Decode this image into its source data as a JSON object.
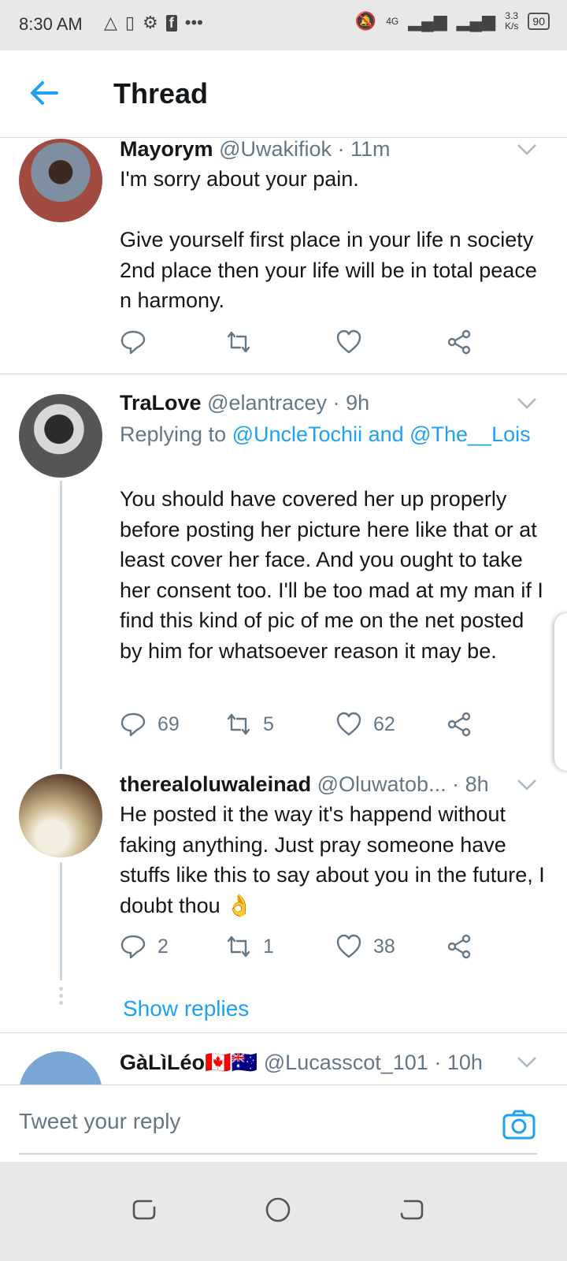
{
  "status_bar": {
    "time": "8:30 AM",
    "network": "4G",
    "speed_value": "3.3",
    "speed_unit": "K/s",
    "battery": "90"
  },
  "header": {
    "title": "Thread"
  },
  "tweets": [
    {
      "name": "Mayorym",
      "handle": "@Uwakifiok",
      "time": "11m",
      "body": "I'm sorry about your pain.\n\nGive yourself first place in your life n society 2nd place then your life will be in total peace n harmony.",
      "replies": "",
      "retweets": "",
      "likes": ""
    },
    {
      "name": "TraLove",
      "handle": "@elantracey",
      "time": "9h",
      "replying_prefix": "Replying to ",
      "replying_to": "@UncleTochii and @The__Lois",
      "body": "You should have covered her up properly before posting her picture here like that or at least cover her face. And you ought to take her consent too. I'll be too mad at my man if I find this kind of pic of me on the net posted by him for whatsoever reason it may be.",
      "replies": "69",
      "retweets": "5",
      "likes": "62"
    },
    {
      "name": "therealoluwaleinad",
      "handle": "@Oluwatob...",
      "time": "8h",
      "body": "He posted it the way it's happend without faking anything. Just pray someone have stuffs like this to say about you in the future, I doubt thou 👌",
      "replies": "2",
      "retweets": "1",
      "likes": "38"
    },
    {
      "name": "GàLìLéo🇨🇦🇦🇺",
      "handle": "@Lucasscot_101",
      "time": "10h"
    }
  ],
  "show_replies": "Show replies",
  "reply_bar": {
    "placeholder": "Tweet your reply"
  },
  "colors": {
    "accent": "#1da1f2",
    "muted": "#657786",
    "divider": "#d6dbdf"
  }
}
